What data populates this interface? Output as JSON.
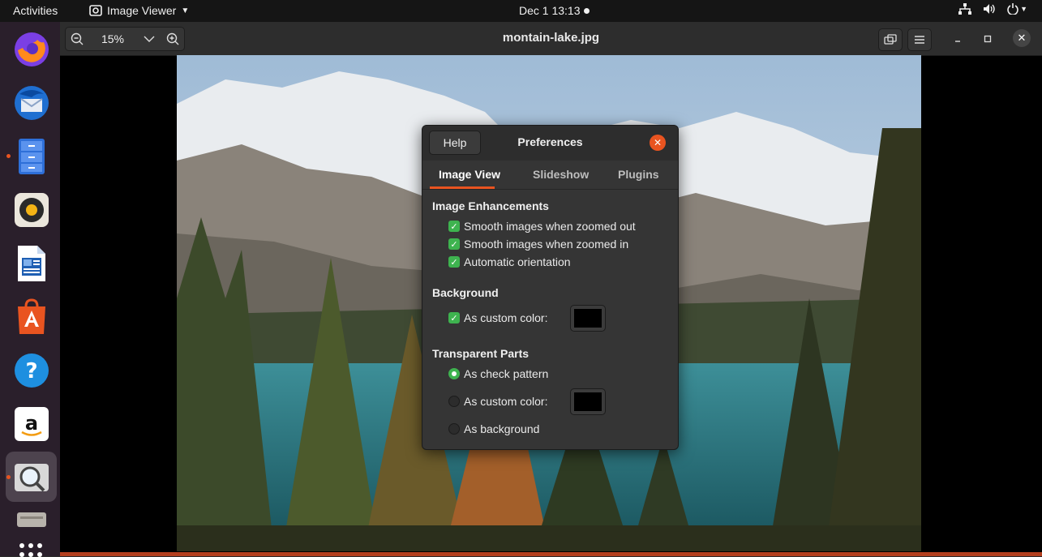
{
  "topbar": {
    "activities": "Activities",
    "app_name": "Image Viewer",
    "datetime": "Dec 1  13:13"
  },
  "dock": {
    "items": [
      "firefox-icon",
      "thunderbird-icon",
      "files-icon",
      "rhythmbox-icon",
      "writer-icon",
      "software-icon",
      "help-icon",
      "amazon-icon",
      "image-viewer-icon",
      "disk-icon"
    ]
  },
  "window": {
    "title": "montain-lake.jpg",
    "zoom": "15%"
  },
  "dialog": {
    "help_label": "Help",
    "title": "Preferences",
    "tabs": [
      "Image View",
      "Slideshow",
      "Plugins"
    ],
    "sections": {
      "enhancements": "Image Enhancements",
      "background": "Background",
      "transparent": "Transparent Parts"
    },
    "options": {
      "smooth_out": "Smooth images when zoomed out",
      "smooth_in": "Smooth images when zoomed in",
      "auto_orient": "Automatic orientation",
      "bg_custom": "As custom color:",
      "tp_check": "As check pattern",
      "tp_custom": "As custom color:",
      "tp_background": "As background"
    }
  },
  "colors": {
    "accent": "#e95420",
    "check": "#3eb34f",
    "custom_color": "#000000"
  }
}
